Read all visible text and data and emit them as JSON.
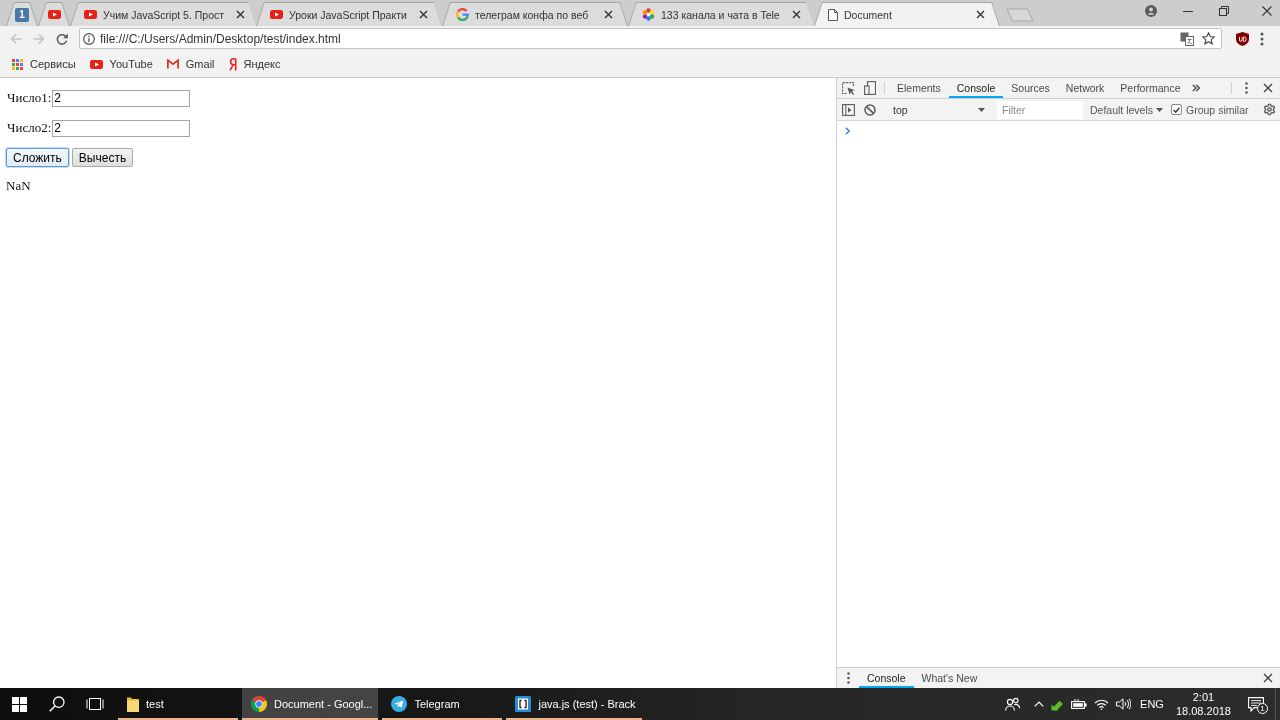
{
  "browser": {
    "tabs": [
      {
        "kind": "pinned",
        "badge": "1",
        "selected": false
      },
      {
        "kind": "pinned",
        "selected": false
      },
      {
        "kind": "normal",
        "title": "Учим JavaScript 5. Прост",
        "selected": false
      },
      {
        "kind": "normal",
        "title": "Уроки JavaScript Практи",
        "selected": false
      },
      {
        "kind": "normal",
        "title": "телеграм конфа по веб",
        "selected": false
      },
      {
        "kind": "normal",
        "title": "133 канала и чата в Tele",
        "selected": false
      },
      {
        "kind": "normal",
        "title": "Document",
        "selected": true
      }
    ],
    "toolbar": {
      "back": {
        "disabled": true
      },
      "forward": {
        "disabled": true
      },
      "url": "file:///C:/Users/Admin/Desktop/test/index.html"
    },
    "bookmarks": [
      {
        "label": "Сервисы"
      },
      {
        "label": "YouTube"
      },
      {
        "label": "Gmail"
      },
      {
        "label": "Яндекс"
      }
    ]
  },
  "page": {
    "fields": [
      {
        "label": "Число1:",
        "value": "2"
      },
      {
        "label": "Число2:",
        "value": "2"
      }
    ],
    "buttons": [
      {
        "label": "Сложить",
        "focused": true
      },
      {
        "label": "Вычесть",
        "focused": false
      }
    ],
    "result": "NaN"
  },
  "devtools": {
    "tabs": [
      {
        "label": "Elements",
        "selected": false
      },
      {
        "label": "Console",
        "selected": true
      },
      {
        "label": "Sources",
        "selected": false
      },
      {
        "label": "Network",
        "selected": false
      },
      {
        "label": "Performance",
        "selected": false
      }
    ],
    "console_toolbar": {
      "context": "top",
      "filter": {
        "placeholder": "Filter"
      },
      "levels": "Default levels",
      "group_similar": {
        "label": "Group similar",
        "checked": true
      }
    },
    "drawer_tabs": [
      {
        "label": "Console",
        "selected": true
      },
      {
        "label": "What's New",
        "selected": false
      }
    ]
  },
  "taskbar": {
    "apps": [
      {
        "label": "test",
        "active": false,
        "running": true
      },
      {
        "label": "Document - Googl...",
        "active": true,
        "running": true
      },
      {
        "label": "Telegram",
        "active": false,
        "running": true
      },
      {
        "label": "java.js (test) - Brack",
        "active": false,
        "running": true
      }
    ],
    "tray": {
      "language": "ENG",
      "time": "2:01",
      "date": "18.08.2018",
      "notifications": "1"
    }
  }
}
